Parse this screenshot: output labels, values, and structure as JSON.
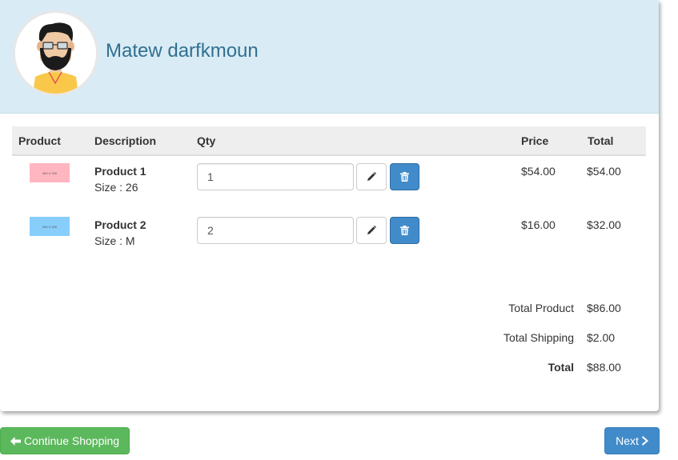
{
  "user": {
    "name": "Matew darfkmoun",
    "avatar_icon": "bearded-man-avatar-icon"
  },
  "table": {
    "headers": {
      "product": "Product",
      "description": "Description",
      "qty": "Qty",
      "price": "Price",
      "total": "Total"
    },
    "rows": [
      {
        "thumb_text": "400 X 200",
        "thumb_color": "#ffb6c1",
        "name": "Product 1",
        "size": "Size : 26",
        "qty": "1",
        "price": "$54.00",
        "total": "$54.00"
      },
      {
        "thumb_text": "400 X 200",
        "thumb_color": "#87cefa",
        "name": "Product 2",
        "size": "Size : M",
        "qty": "2",
        "price": "$16.00",
        "total": "$32.00"
      }
    ]
  },
  "summary": {
    "total_product_label": "Total Product",
    "total_product_value": "$86.00",
    "total_shipping_label": "Total Shipping",
    "total_shipping_value": "$2.00",
    "total_label": "Total",
    "total_value": "$88.00"
  },
  "buttons": {
    "continue_label": "Continue Shopping",
    "next_label": "Next"
  },
  "colors": {
    "header_bg": "#d9ebf5",
    "name_color": "#31708f",
    "success": "#5cb85c",
    "primary": "#428bca"
  }
}
